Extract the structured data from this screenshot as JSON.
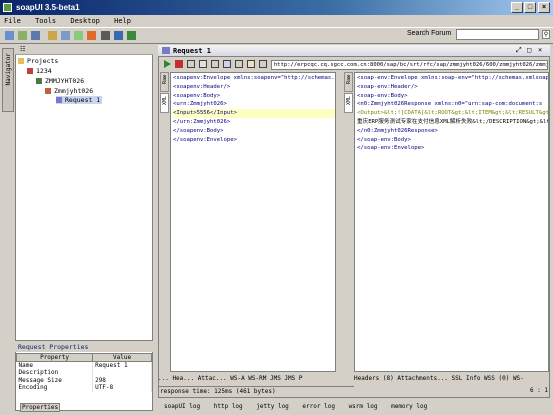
{
  "app": {
    "title": "soapUI 3.5-beta1"
  },
  "menu": [
    "File",
    "Tools",
    "Desktop",
    "Help"
  ],
  "search": {
    "label": "Search Forum"
  },
  "navigator": {
    "tab_label": "Navigator",
    "tree": [
      {
        "label": "Projects",
        "level": 0,
        "icon": "folder-icon"
      },
      {
        "label": "1234",
        "level": 1,
        "icon": "project-icon"
      },
      {
        "label": "ZMMJYHT026",
        "level": 2,
        "icon": "interface-icon"
      },
      {
        "label": "Zmmjyht026",
        "level": 3,
        "icon": "operation-icon"
      },
      {
        "label": "Request 1",
        "level": 4,
        "icon": "request-icon",
        "selected": true
      }
    ]
  },
  "properties": {
    "title": "Request Properties",
    "headers": [
      "Property",
      "Value"
    ],
    "rows": [
      [
        "Name",
        "Request 1"
      ],
      [
        "Description",
        ""
      ],
      [
        "Message Size",
        "298"
      ],
      [
        "Encoding",
        "UTF-8"
      ]
    ],
    "button": "Properties"
  },
  "request": {
    "title": "Request 1",
    "url": "http://erpcqc.cq.sgcc.com.cn:8000/sap/bc/srt/rfc/sap/zmmjyht026/600/zmmjyht026/zmmjyht026",
    "left_tabs": [
      "Raw",
      "XML"
    ],
    "right_tabs": [
      "Raw",
      "XML"
    ],
    "req_xml": [
      "<soapenv:Envelope xmlns:soapenv=\"http://schemas.xmlsoap",
      "   <soapenv:Header/>",
      "   <soapenv:Body>",
      "      <urn:Zmmjyht026>",
      "         <Input>5556</Input>",
      "      </urn:Zmmjyht026>",
      "   </soapenv:Body>",
      "</soapenv:Envelope>"
    ],
    "resp_xml": [
      "<soap-env:Envelope xmlns:soap-env=\"http://schemas.xmlsoap.org/",
      "   <soap-env:Header/>",
      "   <soap-env:Body>",
      "      <n0:Zmmjyht026Response xmlns:n0=\"urn:sap-com:document:s",
      "         <Output>&lt;![CDATA[&lt;ROOT&gt;&lt;ITEM&gt;&lt;RESULT&gt;0&lt;/RESULT&gt;&lt;D",
      "重庆ERP服务测试专家在支付信息XML解析失败&lt;/DESCRIPTION&gt;&lt;/ITEM",
      "      </n0:Zmmjyht026Response>",
      "   </soap-env:Body>",
      "</soap-env:Envelope>"
    ],
    "left_bottom_tabs": "... Hea...   Attac...  WS-A  WS-RM  JMS  JMS P",
    "right_bottom_tabs": "Headers (8)   Attachments...  SSL Info  WSS (0)  WS-",
    "response_time": "response time: 125ms (461 bytes)",
    "cursor_pos": "6 : 1"
  },
  "logs": [
    "soapUI log",
    "http log",
    "jetty log",
    "error log",
    "wsrm log",
    "memory log"
  ],
  "colors": {
    "title_start": "#0a246a",
    "title_end": "#a6caf0",
    "tag": "#000080",
    "attr": "#800080"
  }
}
